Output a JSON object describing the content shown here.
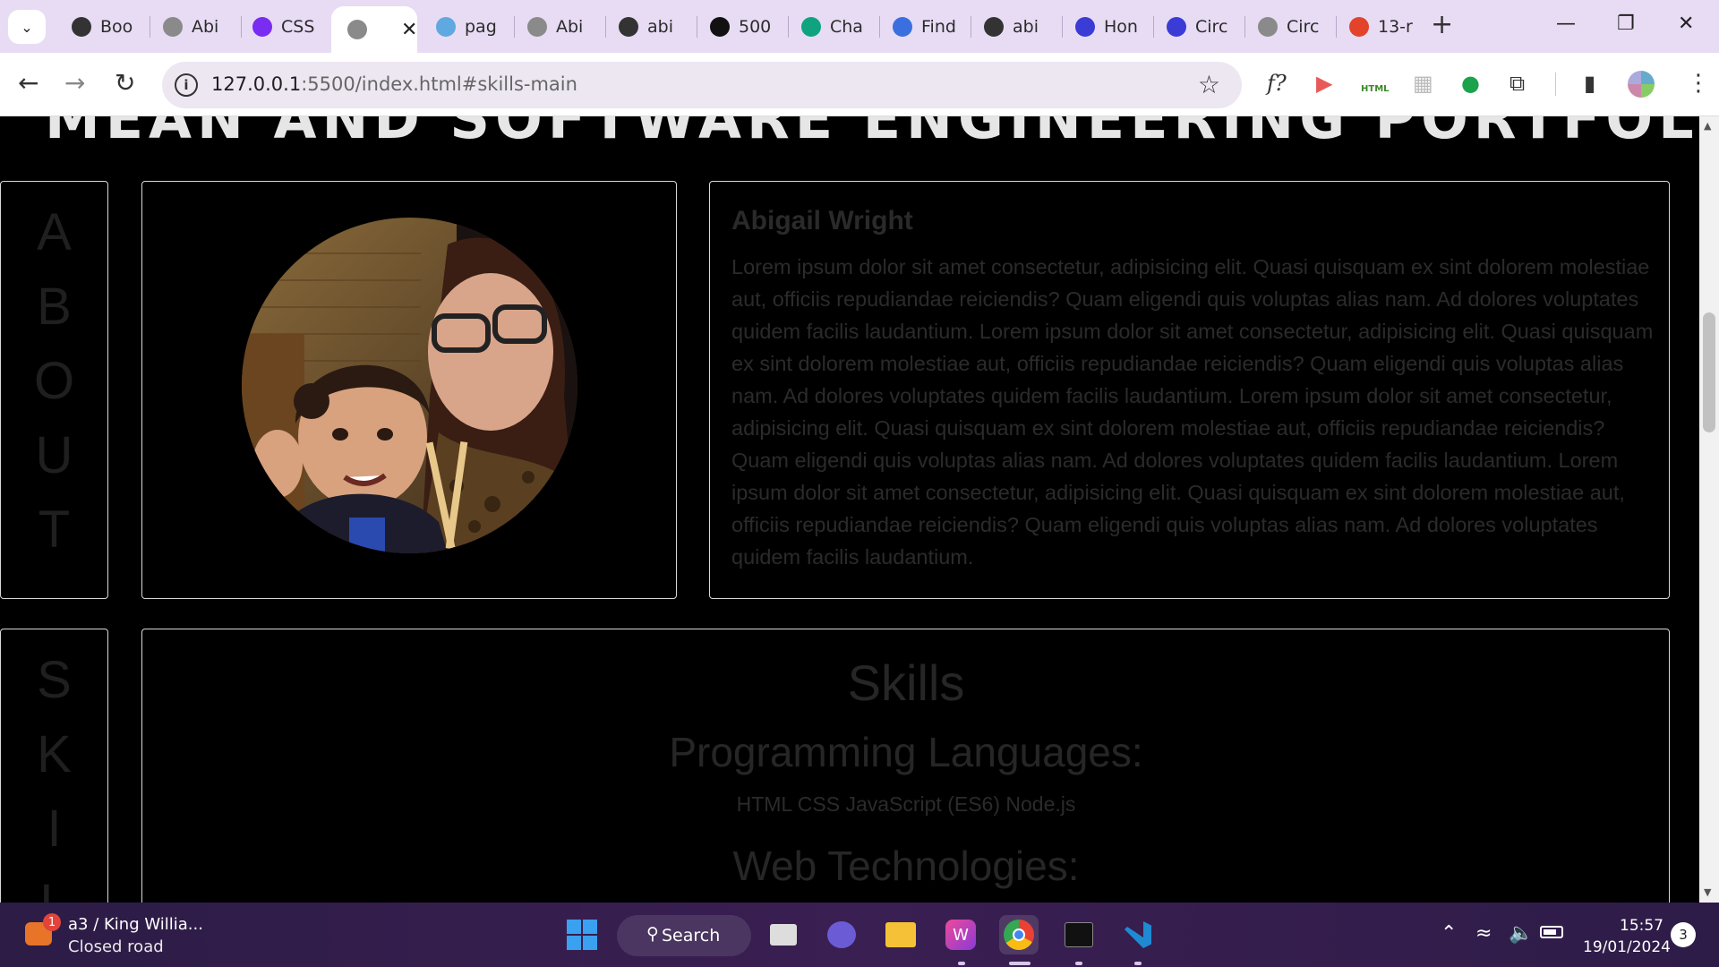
{
  "browser": {
    "tabs": [
      {
        "title": "Boo",
        "icon": "github-icon",
        "color": "#333333"
      },
      {
        "title": "Abi",
        "icon": "globe-icon",
        "color": "#8a8a8a"
      },
      {
        "title": "CSS",
        "icon": "bootstrap-icon",
        "color": "#7a2cf0"
      },
      {
        "title": "",
        "icon": "globe-icon",
        "color": "#8a8a8a",
        "active": true
      },
      {
        "title": "pag",
        "icon": "copilot-icon",
        "color": "#5fa8e0"
      },
      {
        "title": "Abi",
        "icon": "globe-icon",
        "color": "#8a8a8a"
      },
      {
        "title": "abi",
        "icon": "github-icon",
        "color": "#333333"
      },
      {
        "title": "500",
        "icon": "unsplash-icon",
        "color": "#111111"
      },
      {
        "title": "Cha",
        "icon": "chatgpt-icon",
        "color": "#10a37f"
      },
      {
        "title": "Find",
        "icon": "flag-icon",
        "color": "#3b6fe0"
      },
      {
        "title": "abi",
        "icon": "github-icon",
        "color": "#333333"
      },
      {
        "title": "Hon",
        "icon": "circle-c-icon",
        "color": "#3b3bd6"
      },
      {
        "title": "Circ",
        "icon": "circle-c-icon",
        "color": "#3b3bd6"
      },
      {
        "title": "Circ",
        "icon": "globe-icon",
        "color": "#8a8a8a"
      },
      {
        "title": "13-r",
        "icon": "gitlab-icon",
        "color": "#e2432a"
      }
    ],
    "close_glyph": "✕",
    "new_tab_glyph": "+",
    "url_host": "127.0.0.1",
    "url_path": ":5500/index.html#skills-main",
    "extensions": [
      "f?",
      "▶",
      "HTML",
      "▦",
      "●",
      "⧉",
      "▮"
    ]
  },
  "page": {
    "cut_heading": "MEAN AND SOFTWARE ENGINEERING PORTFOLIO",
    "about": {
      "letters": [
        "A",
        "B",
        "O",
        "U",
        "T"
      ],
      "name": "Abigail Wright",
      "text": "Lorem ipsum dolor sit amet consectetur, adipisicing elit. Quasi quisquam ex sint dolorem molestiae aut, officiis repudiandae reiciendis? Quam eligendi quis voluptas alias nam. Ad dolores voluptates quidem facilis laudantium. Lorem ipsum dolor sit amet consectetur, adipisicing elit. Quasi quisquam ex sint dolorem molestiae aut, officiis repudiandae reiciendis? Quam eligendi quis voluptas alias nam. Ad dolores voluptates quidem facilis laudantium. Lorem ipsum dolor sit amet consectetur, adipisicing elit. Quasi quisquam ex sint dolorem molestiae aut, officiis repudiandae reiciendis? Quam eligendi quis voluptas alias nam. Ad dolores voluptates quidem facilis laudantium. Lorem ipsum dolor sit amet consectetur, adipisicing elit. Quasi quisquam ex sint dolorem molestiae aut, officiis repudiandae reiciendis? Quam eligendi quis voluptas alias nam. Ad dolores voluptates quidem facilis laudantium."
    },
    "skills": {
      "letters": [
        "S",
        "K",
        "I",
        "L"
      ],
      "title": "Skills",
      "sub1": "Programming Languages:",
      "langs": "HTML CSS JavaScript (ES6) Node.js",
      "sub2": "Web Technologies:"
    }
  },
  "taskbar": {
    "weather_title": "a3 / King Willia...",
    "weather_sub": "Closed road",
    "weather_badge": "1",
    "search_label": "Search",
    "time": "15:57",
    "date": "19/01/2024",
    "notifications": "3"
  }
}
